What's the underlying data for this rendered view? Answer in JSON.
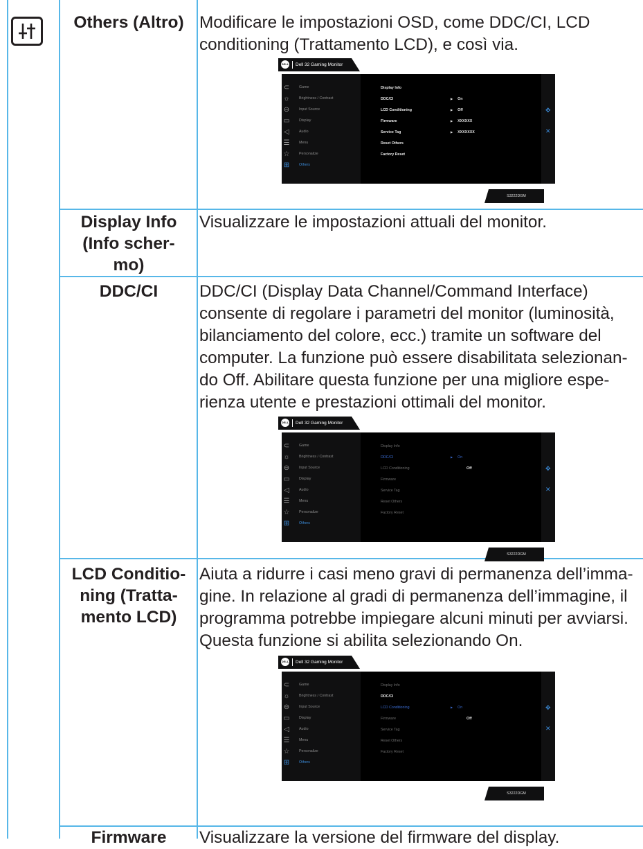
{
  "rows": [
    {
      "label_lines": [
        "Others (Altro)"
      ],
      "description": [
        "Modificare le impostazioni OSD, come DDC/CI, LCD",
        "conditioning (Trattamento LCD), e così via."
      ]
    },
    {
      "label_lines": [
        "Display Info",
        "(Info scher-",
        "mo)"
      ],
      "description": [
        "Visualizzare le impostazioni attuali del monitor."
      ]
    },
    {
      "label_lines": [
        "DDC/CI"
      ],
      "description": [
        "DDC/CI (Display Data Channel/Command Interface)",
        "consente di regolare i parametri del monitor (luminosità,",
        "bilanciamento del colore, ecc.) tramite un software del",
        "computer. La funzione può essere disabilitata selezionan-",
        "do Off. Abilitare questa funzione per una migliore espe-",
        "rienza utente e prestazioni ottimali del monitor."
      ]
    },
    {
      "label_lines": [
        "LCD Conditio-",
        "ning (Tratta-",
        "mento LCD)"
      ],
      "description": [
        "Aiuta a ridurre i casi meno gravi di permanenza dell’imma-",
        "gine. In relazione al gradi di permanenza dell’immagine, il",
        "programma potrebbe impiegare alcuni minuti per avviarsi.",
        "Questa funzione si abilita selezionando On."
      ]
    },
    {
      "label_lines": [
        "Firmware"
      ],
      "description": [
        "Visualizzare la versione del firmware del display."
      ]
    }
  ],
  "osd": {
    "brand_logo": "DELL",
    "title": "Dell 32 Gaming Monitor",
    "model": "S3222DGM",
    "menu": [
      "Game",
      "Brightness / Contrast",
      "Input Source",
      "Display",
      "Audio",
      "Menu",
      "Personalize",
      "Others"
    ],
    "menu_icons": [
      "game-icon",
      "brightness-icon",
      "input-source-icon",
      "display-icon",
      "audio-icon",
      "menu-icon",
      "personalize-icon",
      "others-icon"
    ],
    "options": [
      "Display Info",
      "DDC/CI",
      "LCD Conditioning",
      "Firmware",
      "Service Tag",
      "Reset Others",
      "Factory Reset"
    ],
    "values_main": [
      "On",
      "Off",
      "XXXXXX",
      "XXXXXXX"
    ],
    "on_label": "On",
    "off_label": "Off",
    "accent_color": "#3b8bd9"
  }
}
